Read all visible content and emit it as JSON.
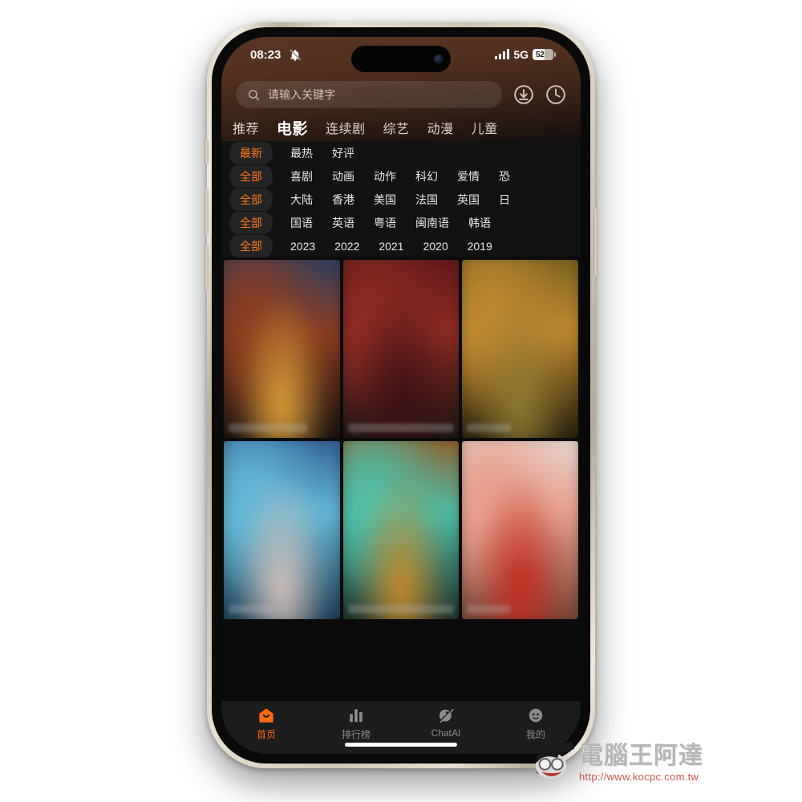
{
  "status_bar": {
    "time": "08:23",
    "mute_icon": "bell-slash-icon",
    "signal_icon": "signal-bars-icon",
    "network": "5G",
    "battery_level": "52"
  },
  "header": {
    "search": {
      "icon": "search-icon",
      "placeholder": "请输入关键字",
      "value": ""
    },
    "download_icon": "download-circle-icon",
    "history_icon": "history-clock-icon"
  },
  "category_tabs": [
    {
      "label": "推荐",
      "active": false
    },
    {
      "label": "电影",
      "active": true
    },
    {
      "label": "连续剧",
      "active": false
    },
    {
      "label": "综艺",
      "active": false
    },
    {
      "label": "动漫",
      "active": false
    },
    {
      "label": "儿童",
      "active": false
    }
  ],
  "filters": [
    {
      "name": "sort",
      "chip": "最新",
      "items": [
        "最热",
        "好评"
      ]
    },
    {
      "name": "genre",
      "chip": "全部",
      "items": [
        "喜剧",
        "动画",
        "动作",
        "科幻",
        "爱情",
        "恐"
      ]
    },
    {
      "name": "region",
      "chip": "全部",
      "items": [
        "大陆",
        "香港",
        "美国",
        "法国",
        "英国",
        "日"
      ]
    },
    {
      "name": "language",
      "chip": "全部",
      "items": [
        "国语",
        "英语",
        "粤语",
        "闽南语",
        "韩语"
      ]
    },
    {
      "name": "year",
      "chip": "全部",
      "items": [
        "2023",
        "2022",
        "2021",
        "2020",
        "2019"
      ]
    }
  ],
  "posters": [
    {
      "name": "poster-1",
      "c1": "#1d3f6e",
      "c2": "#8a3c20",
      "c3": "#e0a23a",
      "c4": "#0d0c0c",
      "title_w": "mid"
    },
    {
      "name": "poster-2",
      "c1": "#5a1417",
      "c2": "#8c2b22",
      "c3": "#3b1013",
      "c4": "#101010",
      "title_w": "wide"
    },
    {
      "name": "poster-3",
      "c1": "#6d5a1c",
      "c2": "#c08a30",
      "c3": "#8f7a33",
      "c4": "#161308",
      "title_w": "short"
    },
    {
      "name": "poster-4",
      "c1": "#2a4f86",
      "c2": "#63b7d6",
      "c3": "#d8c4bd",
      "c4": "#123048",
      "title_w": "short"
    },
    {
      "name": "poster-5",
      "c1": "#9b4b13",
      "c2": "#4fbfa8",
      "c3": "#c98c2e",
      "c4": "#13201c",
      "title_w": "wide"
    },
    {
      "name": "poster-6",
      "c1": "#e6ded8",
      "c2": "#e8a08c",
      "c3": "#c42a20",
      "c4": "#6a3c2c",
      "title_w": "short"
    }
  ],
  "tab_bar": [
    {
      "label": "首页",
      "icon": "home-icon",
      "active": true
    },
    {
      "label": "排行榜",
      "icon": "chart-bars-icon",
      "active": false
    },
    {
      "label": "ChatAI",
      "icon": "planet-icon",
      "active": false
    },
    {
      "label": "我的",
      "icon": "person-face-icon",
      "active": false
    }
  ],
  "watermark": {
    "title": "電腦王阿達",
    "url": "http://www.kocpc.com.tw"
  },
  "colors": {
    "accent": "#ff7a1f",
    "tab_active": "#ff6a14",
    "header_top": "#5a3524",
    "screen_bg": "#0b0b0b"
  }
}
